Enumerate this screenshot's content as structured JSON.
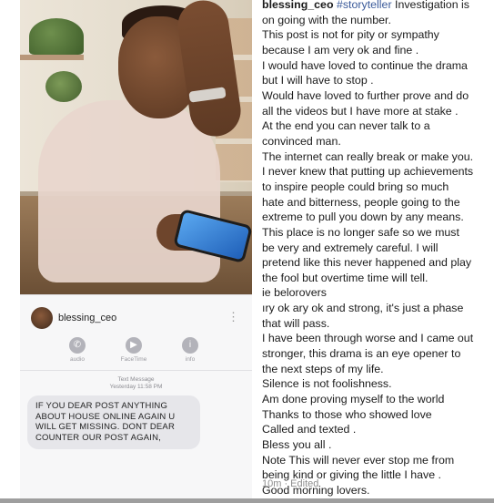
{
  "message_screenshot": {
    "contact_name": "blessing_ceo",
    "more_icon": "vertical-ellipsis-icon",
    "actions": [
      {
        "label": "audio",
        "icon": "phone-icon"
      },
      {
        "label": "FaceTime",
        "icon": "video-camera-icon"
      },
      {
        "label": "info",
        "icon": "info-icon"
      }
    ],
    "meta_line1": "Text Message",
    "meta_line2": "Yesterday 11:58 PM",
    "bubble_text": "IF YOU DEAR POST ANYTHING ABOUT HOUSE ONLINE AGAIN U WILL GET MISSING. DONT DEAR COUNTER OUR POST AGAIN,"
  },
  "caption": {
    "username": "blessing_ceo",
    "hashtag": "#storyteller",
    "head_text": " Investigation is",
    "lines": [
      "on going with the number.",
      "This post is not for pity or sympathy",
      "because I am very ok and fine .",
      "I would have loved to continue the drama",
      "but I will have to stop .",
      "Would have loved to further prove and do",
      "all the videos but I have more at stake .",
      "At the end you can never talk to a",
      "convinced man.",
      "The internet can really break or make you.",
      "I never knew that putting up achievements",
      "to inspire people could bring so much",
      "hate and bitterness, people going to the",
      "extreme to pull you down by any means.",
      "This place is no longer safe so we must",
      "be very and extremely careful. I will",
      "pretend like this never happened and play",
      "the fool but overtime time will tell.",
      "ie belorovers",
      "ıry ok ary ok and strong, it's just a phase",
      "that will pass.",
      "I have been through worse and I came out",
      "stronger, this drama is an eye opener to",
      "the next steps of my life.",
      "Silence is not foolishness.",
      "Am done proving myself to the world",
      "Thanks to those who showed love",
      "Called and texted .",
      "Bless you all .",
      "Note  This will never ever stop me from",
      "being kind or giving the little I have .",
      "Good morning lovers."
    ],
    "footer": "10m · Edited"
  },
  "colors": {
    "hashtag": "#3a5a9a",
    "bubble": "#e6e6ea",
    "meta_text": "#8e8e8e"
  }
}
